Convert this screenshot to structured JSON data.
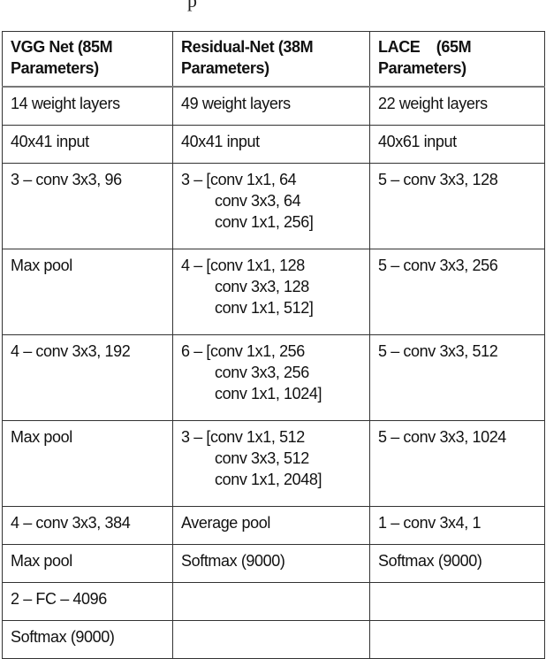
{
  "caption_fragment": "p",
  "table": {
    "headers": [
      [
        "VGG Net (85M",
        "Parameters)"
      ],
      [
        "Residual-Net (38M",
        "Parameters)"
      ],
      [
        "LACE    (65M",
        "Parameters)"
      ]
    ],
    "rows": [
      {
        "cells": [
          [
            "14 weight layers"
          ],
          [
            "49 weight layers"
          ],
          [
            "22 weight layers"
          ]
        ]
      },
      {
        "cells": [
          [
            "40x41 input"
          ],
          [
            "40x41 input"
          ],
          [
            "40x61 input"
          ]
        ]
      },
      {
        "cells": [
          [
            "3 – conv 3x3, 96"
          ],
          [
            "3 – [conv 1x1, 64",
            "conv 3x3, 64",
            "conv 1x1, 256]"
          ],
          [
            "5 – conv 3x3, 128"
          ]
        ]
      },
      {
        "cells": [
          [
            "Max pool"
          ],
          [
            "4 – [conv 1x1, 128",
            "conv 3x3, 128",
            "conv 1x1, 512]"
          ],
          [
            "5 – conv 3x3, 256"
          ]
        ]
      },
      {
        "cells": [
          [
            "4 – conv 3x3, 192"
          ],
          [
            "6 – [conv 1x1, 256",
            "conv 3x3, 256",
            "conv 1x1, 1024]"
          ],
          [
            "5 – conv 3x3, 512"
          ]
        ]
      },
      {
        "cells": [
          [
            "Max pool"
          ],
          [
            "3 – [conv 1x1, 512",
            "conv 3x3, 512",
            "conv 1x1, 2048]"
          ],
          [
            "5 – conv 3x3, 1024"
          ]
        ]
      },
      {
        "cells": [
          [
            "4 – conv 3x3, 384"
          ],
          [
            "Average pool"
          ],
          [
            "1 – conv 3x4, 1"
          ]
        ]
      },
      {
        "cells": [
          [
            "Max pool"
          ],
          [
            "Softmax (9000)"
          ],
          [
            "Softmax (9000)"
          ]
        ]
      },
      {
        "cells": [
          [
            "2 – FC – 4096"
          ],
          [
            ""
          ],
          [
            ""
          ]
        ]
      },
      {
        "cells": [
          [
            "Softmax (9000)"
          ],
          [
            ""
          ],
          [
            ""
          ]
        ]
      }
    ]
  }
}
